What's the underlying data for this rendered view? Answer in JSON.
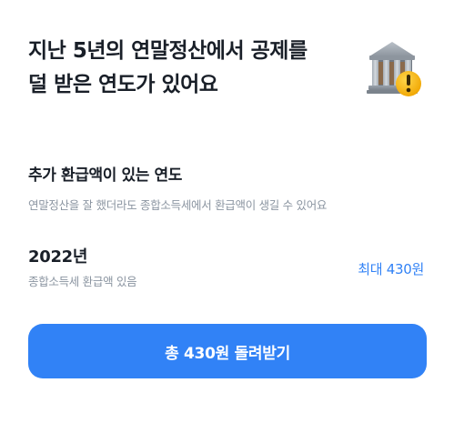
{
  "header": {
    "title_line1": "지난 5년의 연말정산에서 공제를",
    "title_line2": "덜 받은 연도가 있어요",
    "icon": "bank-warning-icon"
  },
  "section": {
    "title": "추가 환급액이 있는 연도",
    "description": "연말정산을 잘 했더라도 종합소득세에서 환급액이 생길 수 있어요"
  },
  "years": [
    {
      "year": "2022년",
      "note": "종합소득세 환급액 있음",
      "amount": "최대 430원"
    }
  ],
  "cta": {
    "label": "총 430원 돌려받기"
  },
  "colors": {
    "accent": "#3182f6",
    "text_primary": "#191f28",
    "text_secondary": "#8b95a1",
    "warning": "#f5b800"
  }
}
